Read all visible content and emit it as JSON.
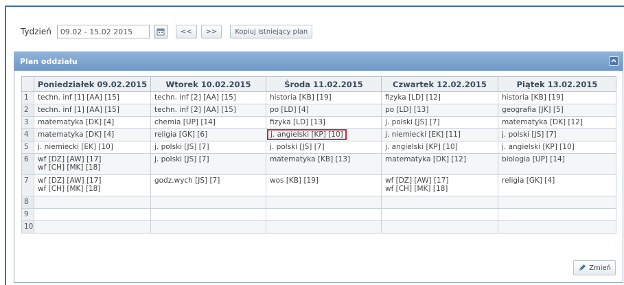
{
  "toolbar": {
    "week_label": "Tydzień",
    "week_value": "09.02 - 15.02 2015",
    "prev_label": "<<",
    "next_label": ">>",
    "copy_plan_label": "Kopiuj istniejący plan"
  },
  "panel": {
    "title": "Plan oddziału",
    "change_label": "Zmień"
  },
  "columns": [
    "Poniedziałek 09.02.2015",
    "Wtorek 10.02.2015",
    "Środa 11.02.2015",
    "Czwartek 12.02.2015",
    "Piątek 13.02.2015"
  ],
  "rows": [
    {
      "n": "1",
      "cells": [
        [
          "techn. inf [1] [AA] [15]"
        ],
        [
          "techn. inf [2] [AA] [15]"
        ],
        [
          "historia [KB] [19]"
        ],
        [
          "fizyka [LD] [12]"
        ],
        [
          "historia [KB] [19]"
        ]
      ]
    },
    {
      "n": "2",
      "cells": [
        [
          "techn. inf [1] [AA] [15]"
        ],
        [
          "techn. inf [2] [AA] [15]"
        ],
        [
          "po [LD] [4]"
        ],
        [
          "po [LD] [13]"
        ],
        [
          "geografia [JK] [5]"
        ]
      ]
    },
    {
      "n": "3",
      "cells": [
        [
          "matematyka [DK] [4]"
        ],
        [
          "chemia [UP] [14]"
        ],
        [
          "fizyka [LD] [13]"
        ],
        [
          "j. polski [JS] [7]"
        ],
        [
          "matematyka [DK] [12]"
        ]
      ]
    },
    {
      "n": "4",
      "cells": [
        [
          "matematyka [DK] [4]"
        ],
        [
          "religia [GK] [6]"
        ],
        [
          "j. angielski [KP] [10]"
        ],
        [
          "j. niemiecki [EK] [11]"
        ],
        [
          "j. polski [JS] [7]"
        ]
      ]
    },
    {
      "n": "5",
      "cells": [
        [
          "j. niemiecki [EK] [10]"
        ],
        [
          "j. polski [JS] [7]"
        ],
        [
          "j. polski [JS] [7]"
        ],
        [
          "j. angielski [KP] [10]"
        ],
        [
          "j. angielski [KP] [10]"
        ]
      ]
    },
    {
      "n": "6",
      "cells": [
        [
          "wf [DZ] [AW] [17]",
          "wf [CH] [MK] [18]"
        ],
        [
          "j. polski [JS] [7]"
        ],
        [
          "matematyka [KB] [13]"
        ],
        [
          "matematyka [DK] [12]"
        ],
        [
          "biologia [UP] [14]"
        ]
      ]
    },
    {
      "n": "7",
      "cells": [
        [
          "wf [DZ] [AW] [17]",
          "wf [CH] [MK] [18]"
        ],
        [
          "godz.wych [JS] [7]"
        ],
        [
          "wos [KB] [19]"
        ],
        [
          "wf [DZ] [AW] [17]",
          "wf [CH] [MK] [18]"
        ],
        [
          "religia [GK] [4]"
        ]
      ]
    },
    {
      "n": "8",
      "cells": [
        [],
        [],
        [],
        [],
        []
      ]
    },
    {
      "n": "9",
      "cells": [
        [],
        [],
        [],
        [],
        []
      ]
    },
    {
      "n": "10",
      "cells": [
        [],
        [],
        [],
        [],
        []
      ]
    }
  ],
  "highlight": {
    "row": 3,
    "col": 2,
    "color": "#d8262e"
  },
  "colors": {
    "header_bar": "#6f98c7",
    "frame": "#3f6fa6"
  }
}
